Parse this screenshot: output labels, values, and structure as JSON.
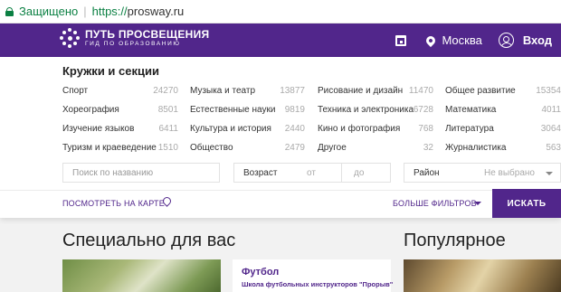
{
  "browser": {
    "secure_label": "Защищено",
    "url_scheme": "https://",
    "url_host": "prosway.ru"
  },
  "header": {
    "logo_title": "ПУТЬ ПРОСВЕЩЕНИЯ",
    "logo_subtitle": "ГИД ПО ОБРАЗОВАНИЮ",
    "city": "Москва",
    "login": "Вход",
    "icons": [
      "calendar-icon",
      "location-pin-icon",
      "user-icon"
    ]
  },
  "filters": {
    "title": "Кружки и секции",
    "categories": [
      {
        "label": "Спорт",
        "count": "24270"
      },
      {
        "label": "Хореография",
        "count": "8501"
      },
      {
        "label": "Изучение языков",
        "count": "6411"
      },
      {
        "label": "Туризм и краеведение",
        "count": "1510"
      },
      {
        "label": "Музыка и театр",
        "count": "13877"
      },
      {
        "label": "Естественные науки",
        "count": "9819"
      },
      {
        "label": "Культура и история",
        "count": "2440"
      },
      {
        "label": "Общество",
        "count": "2479"
      },
      {
        "label": "Рисование и дизайн",
        "count": "11470"
      },
      {
        "label": "Техника и электроника",
        "count": "6728"
      },
      {
        "label": "Кино и фотография",
        "count": "768"
      },
      {
        "label": "Другое",
        "count": "32"
      },
      {
        "label": "Общее развитие",
        "count": "15354"
      },
      {
        "label": "Математика",
        "count": "4011"
      },
      {
        "label": "Литература",
        "count": "3064"
      },
      {
        "label": "Журналистика",
        "count": "563"
      }
    ],
    "search_placeholder": "Поиск по названию",
    "age_label": "Возраст",
    "age_from": "от",
    "age_to": "до",
    "region_label": "Район",
    "region_value": "Не выбрано",
    "map_link": "ПОСМОТРЕТЬ НА КАРТЕ",
    "more_filters": "БОЛЬШЕ ФИЛЬТРОВ",
    "search_button": "ИСКАТЬ"
  },
  "sections": {
    "for_you_title": "Специально для вас",
    "popular_title": "Популярное",
    "card": {
      "title": "Футбол",
      "subtitle": "Школа футбольных инструкторов \"Прорыв\""
    }
  },
  "colors": {
    "brand": "#51268b",
    "secure_green": "#0b8043"
  }
}
